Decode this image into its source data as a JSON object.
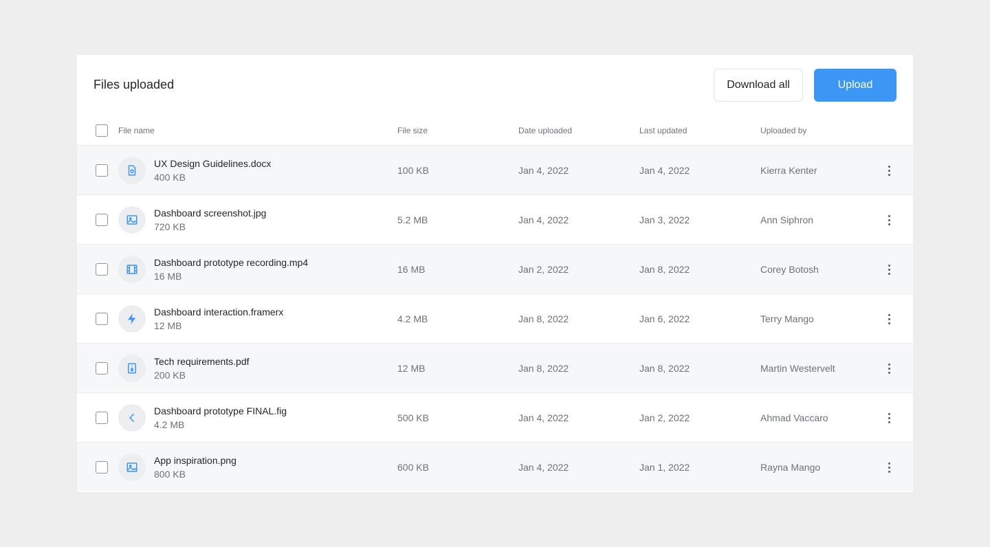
{
  "header": {
    "title": "Files uploaded",
    "download_all_label": "Download all",
    "upload_label": "Upload"
  },
  "columns": {
    "file_name": "File name",
    "file_size": "File size",
    "date_uploaded": "Date uploaded",
    "last_updated": "Last updated",
    "uploaded_by": "Uploaded by"
  },
  "colors": {
    "accent": "#3c96f4",
    "icon": "#3c96f4"
  },
  "rows": [
    {
      "icon": "document-icon",
      "name": "UX Design Guidelines.docx",
      "sub_size": "400 KB",
      "file_size": "100 KB",
      "date_uploaded": "Jan 4, 2022",
      "last_updated": "Jan 4, 2022",
      "uploaded_by": "Kierra Kenter"
    },
    {
      "icon": "image-icon",
      "name": "Dashboard screenshot.jpg",
      "sub_size": "720 KB",
      "file_size": "5.2 MB",
      "date_uploaded": "Jan 4, 2022",
      "last_updated": "Jan 3, 2022",
      "uploaded_by": "Ann Siphron"
    },
    {
      "icon": "film-icon",
      "name": "Dashboard prototype recording.mp4",
      "sub_size": "16 MB",
      "file_size": "16 MB",
      "date_uploaded": "Jan 2, 2022",
      "last_updated": "Jan 8, 2022",
      "uploaded_by": "Corey Botosh"
    },
    {
      "icon": "lightning-icon",
      "name": "Dashboard interaction.framerx",
      "sub_size": "12 MB",
      "file_size": "4.2 MB",
      "date_uploaded": "Jan 8, 2022",
      "last_updated": "Jan 6, 2022",
      "uploaded_by": "Terry Mango"
    },
    {
      "icon": "zip-file-icon",
      "name": "Tech requirements.pdf",
      "sub_size": "200 KB",
      "file_size": "12 MB",
      "date_uploaded": "Jan 8, 2022",
      "last_updated": "Jan 8, 2022",
      "uploaded_by": "Martin Westervelt"
    },
    {
      "icon": "chevron-left-icon",
      "name": "Dashboard prototype FINAL.fig",
      "sub_size": "4.2 MB",
      "file_size": "500 KB",
      "date_uploaded": "Jan 4, 2022",
      "last_updated": "Jan 2, 2022",
      "uploaded_by": "Ahmad Vaccaro"
    },
    {
      "icon": "image-icon",
      "name": "App inspiration.png",
      "sub_size": "800 KB",
      "file_size": "600 KB",
      "date_uploaded": "Jan 4, 2022",
      "last_updated": "Jan 1, 2022",
      "uploaded_by": "Rayna Mango"
    }
  ]
}
